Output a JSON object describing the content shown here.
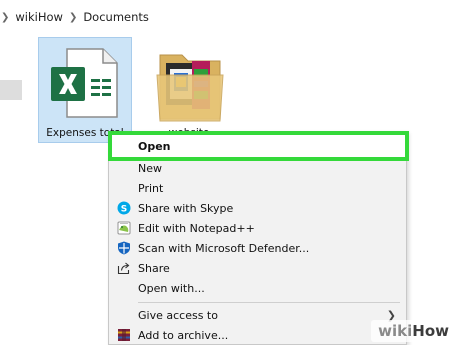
{
  "breadcrumb": {
    "items": [
      "wikiHow",
      "Documents"
    ]
  },
  "files": [
    {
      "label": "Expenses total",
      "icon": "excel-file-icon",
      "selected": true
    },
    {
      "label": "website",
      "icon": "folder-icon",
      "selected": false
    }
  ],
  "context_menu": {
    "items": [
      {
        "label": "Open",
        "icon": "",
        "highlighted": true
      },
      {
        "label": "New",
        "icon": ""
      },
      {
        "label": "Print",
        "icon": ""
      },
      {
        "label": "Share with Skype",
        "icon": "skype-icon"
      },
      {
        "label": "Edit with Notepad++",
        "icon": "notepad-plus-plus-icon"
      },
      {
        "label": "Scan with Microsoft Defender...",
        "icon": "defender-shield-icon"
      },
      {
        "label": "Share",
        "icon": "share-icon"
      },
      {
        "label": "Open with...",
        "icon": ""
      },
      {
        "label": "Give access to",
        "icon": "",
        "has_submenu": true
      },
      {
        "label": "Add to archive...",
        "icon": "winrar-archive-icon"
      }
    ]
  },
  "watermark": {
    "prefix": "wiki",
    "suffix": "How"
  },
  "colors": {
    "highlight_border": "#34d93a",
    "selection_bg": "#cce4f7",
    "excel_green": "#1e7145",
    "folder_tan": "#e8c77a"
  }
}
